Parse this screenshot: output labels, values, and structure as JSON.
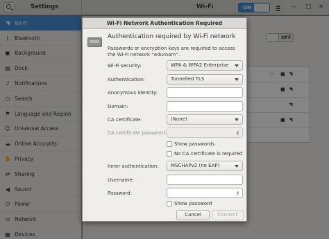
{
  "header": {
    "app_title": "Settings",
    "page_title": "Wi-Fi",
    "wifi_switch_label": "ON"
  },
  "sidebar": {
    "items": [
      {
        "label": "Wi-Fi",
        "icon": "wifi-icon",
        "selected": true
      },
      {
        "label": "Bluetooth",
        "icon": "bluetooth-icon"
      },
      {
        "label": "Background",
        "icon": "background-icon"
      },
      {
        "label": "Dock",
        "icon": "dock-icon"
      },
      {
        "label": "Notifications",
        "icon": "bell-icon"
      },
      {
        "label": "Search",
        "icon": "search-icon"
      },
      {
        "label": "Language and Region",
        "icon": "flag-icon"
      },
      {
        "label": "Universal Access",
        "icon": "accessibility-icon"
      },
      {
        "label": "Online Accounts",
        "icon": "cloud-icon"
      },
      {
        "label": "Privacy",
        "icon": "hand-icon"
      },
      {
        "label": "Sharing",
        "icon": "share-icon"
      },
      {
        "label": "Sound",
        "icon": "speaker-icon"
      },
      {
        "label": "Power",
        "icon": "power-icon"
      },
      {
        "label": "Network",
        "icon": "network-icon"
      },
      {
        "label": "Devices",
        "icon": "printer-icon"
      }
    ]
  },
  "background": {
    "airplane_switch_label": "OFF"
  },
  "dialog": {
    "title": "Wi-Fi Network Authentication Required",
    "heading": "Authentication required by Wi-Fi network",
    "description": "Passwords or encryption keys are required to access the Wi-Fi network “eduroam”.",
    "fields": {
      "wifi_security": {
        "label": "Wi-Fi security:",
        "value": "WPA & WPA2 Enterprise"
      },
      "authentication": {
        "label": "Authentication:",
        "value": "Tunnelled TLS"
      },
      "anonymous_identity": {
        "label": "Anonymous identity:",
        "value": ""
      },
      "domain": {
        "label": "Domain:",
        "value": ""
      },
      "ca_certificate": {
        "label": "CA certificate:",
        "value": "(None)"
      },
      "ca_certificate_password": {
        "label": "CA certificate password:",
        "value": ""
      },
      "show_passwords": {
        "label": "Show passwords",
        "checked": false
      },
      "no_ca_required": {
        "label": "No CA certificate is required",
        "checked": false
      },
      "inner_authentication": {
        "label": "Inner authentication:",
        "value": "MSCHAPv2 (no EAP)"
      },
      "username": {
        "label": "Username:",
        "value": ""
      },
      "password": {
        "label": "Password:",
        "value": ""
      },
      "show_password": {
        "label": "Show password",
        "checked": false
      }
    },
    "buttons": {
      "cancel": "Cancel",
      "connect": "Connect"
    }
  }
}
